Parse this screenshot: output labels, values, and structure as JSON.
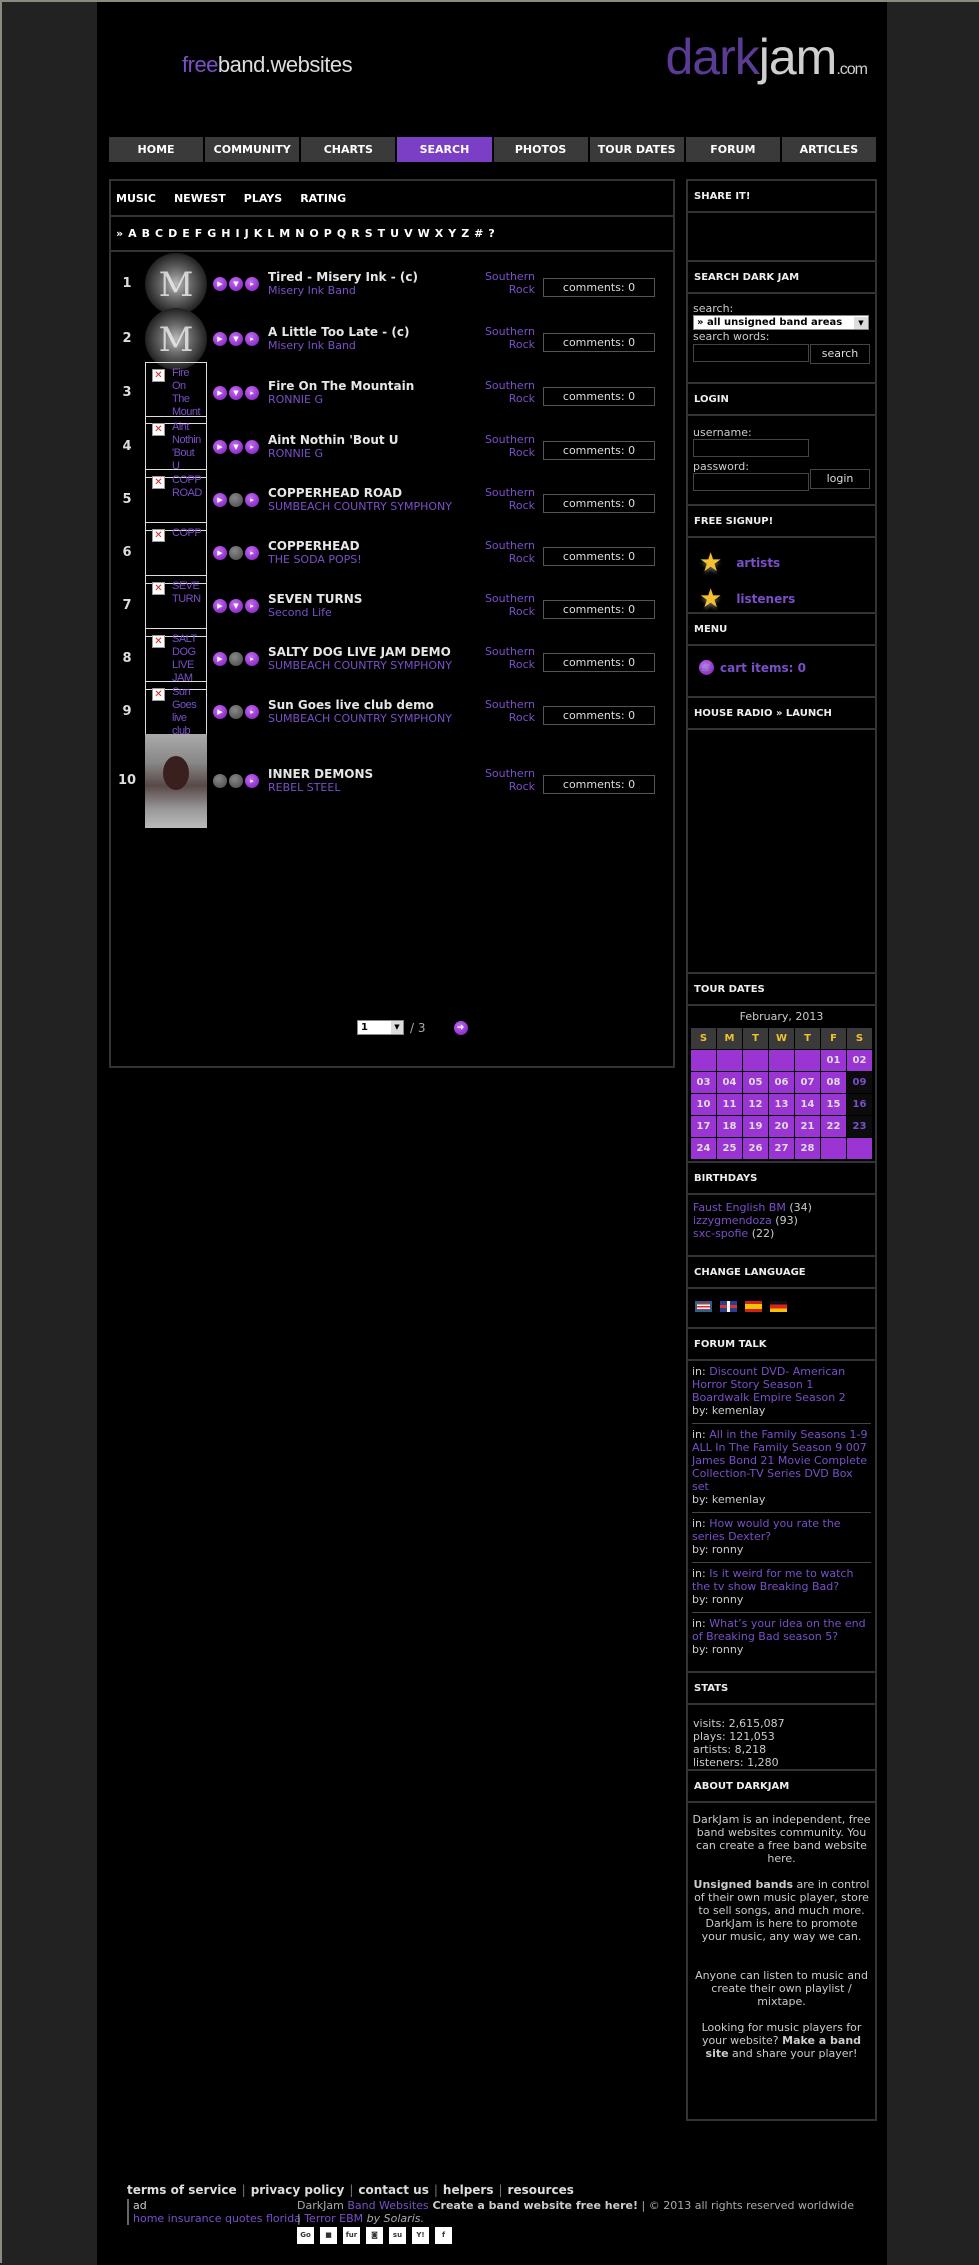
{
  "header": {
    "logo_left_free": "free",
    "logo_left_rest": "band.websites",
    "logo_right_dark": "dark",
    "logo_right_jam": "jam",
    "logo_right_com": ".com"
  },
  "nav": [
    {
      "label": "HOME",
      "active": false
    },
    {
      "label": "COMMUNITY",
      "active": false
    },
    {
      "label": "CHARTS",
      "active": false
    },
    {
      "label": "SEARCH",
      "active": true
    },
    {
      "label": "PHOTOS",
      "active": false
    },
    {
      "label": "TOUR DATES",
      "active": false
    },
    {
      "label": "FORUM",
      "active": false
    },
    {
      "label": "ARTICLES",
      "active": false
    }
  ],
  "colors": {
    "accent": "#7a3fc5",
    "link": "#7a4fc9",
    "calendar_cell": "#9a35d4",
    "calendar_header_text": "#f2c12e"
  },
  "main": {
    "tabs": [
      "MUSIC",
      "NEWEST",
      "PLAYS",
      "RATING"
    ],
    "alpha_prefix": "»",
    "alphabet": [
      "A",
      "B",
      "C",
      "D",
      "E",
      "F",
      "G",
      "H",
      "I",
      "J",
      "K",
      "L",
      "M",
      "N",
      "O",
      "P",
      "Q",
      "R",
      "S",
      "T",
      "U",
      "V",
      "W",
      "X",
      "Y",
      "Z",
      "#",
      "?"
    ],
    "rows": [
      {
        "num": "1",
        "thumb": "logo",
        "alt": "",
        "song": "Tired - Misery Ink - (c)",
        "artist": "Misery Ink Band",
        "genre1": "Southern",
        "genre2": "Rock",
        "comments": "comments: 0",
        "buttons": [
          "play",
          "on",
          "on"
        ]
      },
      {
        "num": "2",
        "thumb": "logo",
        "alt": "",
        "song": "A Little Too Late - (c)",
        "artist": "Misery Ink Band",
        "genre1": "Southern",
        "genre2": "Rock",
        "comments": "comments: 0",
        "buttons": [
          "play",
          "on",
          "on"
        ]
      },
      {
        "num": "3",
        "thumb": "broken",
        "alt": "Fire On The Mount",
        "song": "Fire On The Mountain",
        "artist": "RONNIE G",
        "genre1": "Southern",
        "genre2": "Rock",
        "comments": "comments: 0",
        "buttons": [
          "play",
          "on",
          "on"
        ]
      },
      {
        "num": "4",
        "thumb": "broken",
        "alt": "Aint Nothin 'Bout U",
        "song": "Aint Nothin 'Bout U",
        "artist": "RONNIE G",
        "genre1": "Southern",
        "genre2": "Rock",
        "comments": "comments: 0",
        "buttons": [
          "play",
          "on",
          "on"
        ]
      },
      {
        "num": "5",
        "thumb": "broken",
        "alt": "COPP ROAD",
        "song": "COPPERHEAD ROAD",
        "artist": "SUMBEACH COUNTRY SYMPHONY",
        "genre1": "Southern",
        "genre2": "Rock",
        "comments": "comments: 0",
        "buttons": [
          "play",
          "off",
          "on"
        ]
      },
      {
        "num": "6",
        "thumb": "broken",
        "alt": "COPP",
        "song": "COPPERHEAD",
        "artist": "THE SODA POPS!",
        "genre1": "Southern",
        "genre2": "Rock",
        "comments": "comments: 0",
        "buttons": [
          "play",
          "off",
          "on"
        ]
      },
      {
        "num": "7",
        "thumb": "broken",
        "alt": "SEVE TURN",
        "song": "SEVEN TURNS",
        "artist": "Second Life",
        "genre1": "Southern",
        "genre2": "Rock",
        "comments": "comments: 0",
        "buttons": [
          "play",
          "on",
          "on"
        ]
      },
      {
        "num": "8",
        "thumb": "broken",
        "alt": "SALT DOG LIVE JAM",
        "song": "SALTY DOG LIVE JAM DEMO",
        "artist": "SUMBEACH COUNTRY SYMPHONY",
        "genre1": "Southern",
        "genre2": "Rock",
        "comments": "comments: 0",
        "buttons": [
          "play",
          "off",
          "on"
        ]
      },
      {
        "num": "9",
        "thumb": "broken",
        "alt": "Sun Goes live club",
        "song": "Sun Goes live club demo",
        "artist": "SUMBEACH COUNTRY SYMPHONY",
        "genre1": "Southern",
        "genre2": "Rock",
        "comments": "comments: 0",
        "buttons": [
          "play",
          "off",
          "on"
        ]
      },
      {
        "num": "10",
        "thumb": "demon",
        "alt": "",
        "song": "INNER DEMONS",
        "artist": "REBEL STEEL",
        "genre1": "Southern",
        "genre2": "Rock",
        "comments": "comments: 0",
        "buttons": [
          "off",
          "off",
          "on"
        ]
      }
    ],
    "pager": {
      "current": "1",
      "total": "/ 3"
    }
  },
  "sidebar": {
    "share_title": "SHARE IT!",
    "search_title": "SEARCH DARK JAM",
    "search_label": "search:",
    "search_select": "» all unsigned band areas",
    "search_words_label": "search words:",
    "search_words_value": "",
    "search_button": "search",
    "login_title": "LOGIN",
    "username_label": "username:",
    "username_value": "",
    "password_label": "password:",
    "password_value": "",
    "login_button": "login",
    "signup_title": "FREE SIGNUP!",
    "signup_artists": "artists",
    "signup_listeners": "listeners",
    "menu_title": "MENU",
    "cart": "cart items: 0",
    "radio_title": "HOUSE RADIO » LAUNCH",
    "tour_title": "TOUR DATES",
    "calendar": {
      "month": "February, 2013",
      "weekdays": [
        "S",
        "M",
        "T",
        "W",
        "T",
        "F",
        "S"
      ],
      "weeks": [
        [
          "",
          "",
          "",
          "",
          "",
          "01",
          "02"
        ],
        [
          "03",
          "04",
          "05",
          "06",
          "07",
          "08",
          "09"
        ],
        [
          "10",
          "11",
          "12",
          "13",
          "14",
          "15",
          "16"
        ],
        [
          "17",
          "18",
          "19",
          "20",
          "21",
          "22",
          "23"
        ],
        [
          "24",
          "25",
          "26",
          "27",
          "28",
          "",
          ""
        ]
      ],
      "dark_days": [
        "09",
        "16",
        "23"
      ]
    },
    "birthdays_title": "BIRTHDAYS",
    "birthdays": [
      {
        "name": "Faust English BM",
        "age": "(34)"
      },
      {
        "name": "izzygmendoza",
        "age": "(93)"
      },
      {
        "name": "sxc-spofie",
        "age": "(22)"
      }
    ],
    "language_title": "CHANGE LANGUAGE",
    "languages": [
      "english-us",
      "english-uk",
      "spanish",
      "german"
    ],
    "forum_title": "FORUM TALK",
    "forum": [
      {
        "in": "in:",
        "topic": "Discount DVD- American Horror Story Season 1 Boardwalk Empire Season 2",
        "by": "by: kemenlay"
      },
      {
        "in": "in:",
        "topic": "All in the Family Seasons 1-9 ALL In The Family Season 9 007 James Bond 21 Movie Complete Collection-TV Series DVD Box set",
        "by": "by: kemenlay"
      },
      {
        "in": "in:",
        "topic": "How would you rate the series Dexter?",
        "by": "by: ronny"
      },
      {
        "in": "in:",
        "topic": "Is it weird for me to watch the tv show Breaking Bad?",
        "by": "by: ronny"
      },
      {
        "in": "in:",
        "topic": "What’s your idea on the end of Breaking Bad season 5?",
        "by": "by: ronny"
      }
    ],
    "stats_title": "STATS",
    "stats": [
      "visits: 2,615,087",
      "plays: 121,053",
      "artists: 8,218",
      "listeners: 1,280"
    ],
    "about_title": "ABOUT DARKJAM",
    "about_p1": "DarkJam is an independent, free band websites community. You can create a free band website here.",
    "about_p2_bold": "Unsigned bands",
    "about_p2_rest": " are in control of their own music player, store to sell songs, and much more. DarkJam is here to promote your music, any way we can.",
    "about_p3": "Anyone can listen to music and create their own playlist / mixtape.",
    "about_p4_a": "Looking for music players for your website? ",
    "about_p4_bold": "Make a band site",
    "about_p4_b": " and share your player!"
  },
  "footer": {
    "links": [
      "terms of service",
      "privacy policy",
      "contact us",
      "helpers",
      "resources"
    ],
    "ad_label": "ad",
    "ad_link": "home insurance quotes florida",
    "copy_a": "DarkJam ",
    "copy_link1": "Band Websites",
    "copy_bold": " Create a band website free here!",
    "copy_b": " | © 2013 all rights reserved worldwide | ",
    "copy_link2": "Terror EBM",
    "copy_c": " by Solaris.",
    "bookmark_icons": [
      "google-bookmarks",
      "delicious",
      "furl",
      "digg",
      "stumbleupon",
      "yahoo",
      "facebook"
    ],
    "bookmark_glyphs": [
      "Go",
      "■",
      "fur",
      "◙",
      "su",
      "Y!",
      "f"
    ]
  }
}
